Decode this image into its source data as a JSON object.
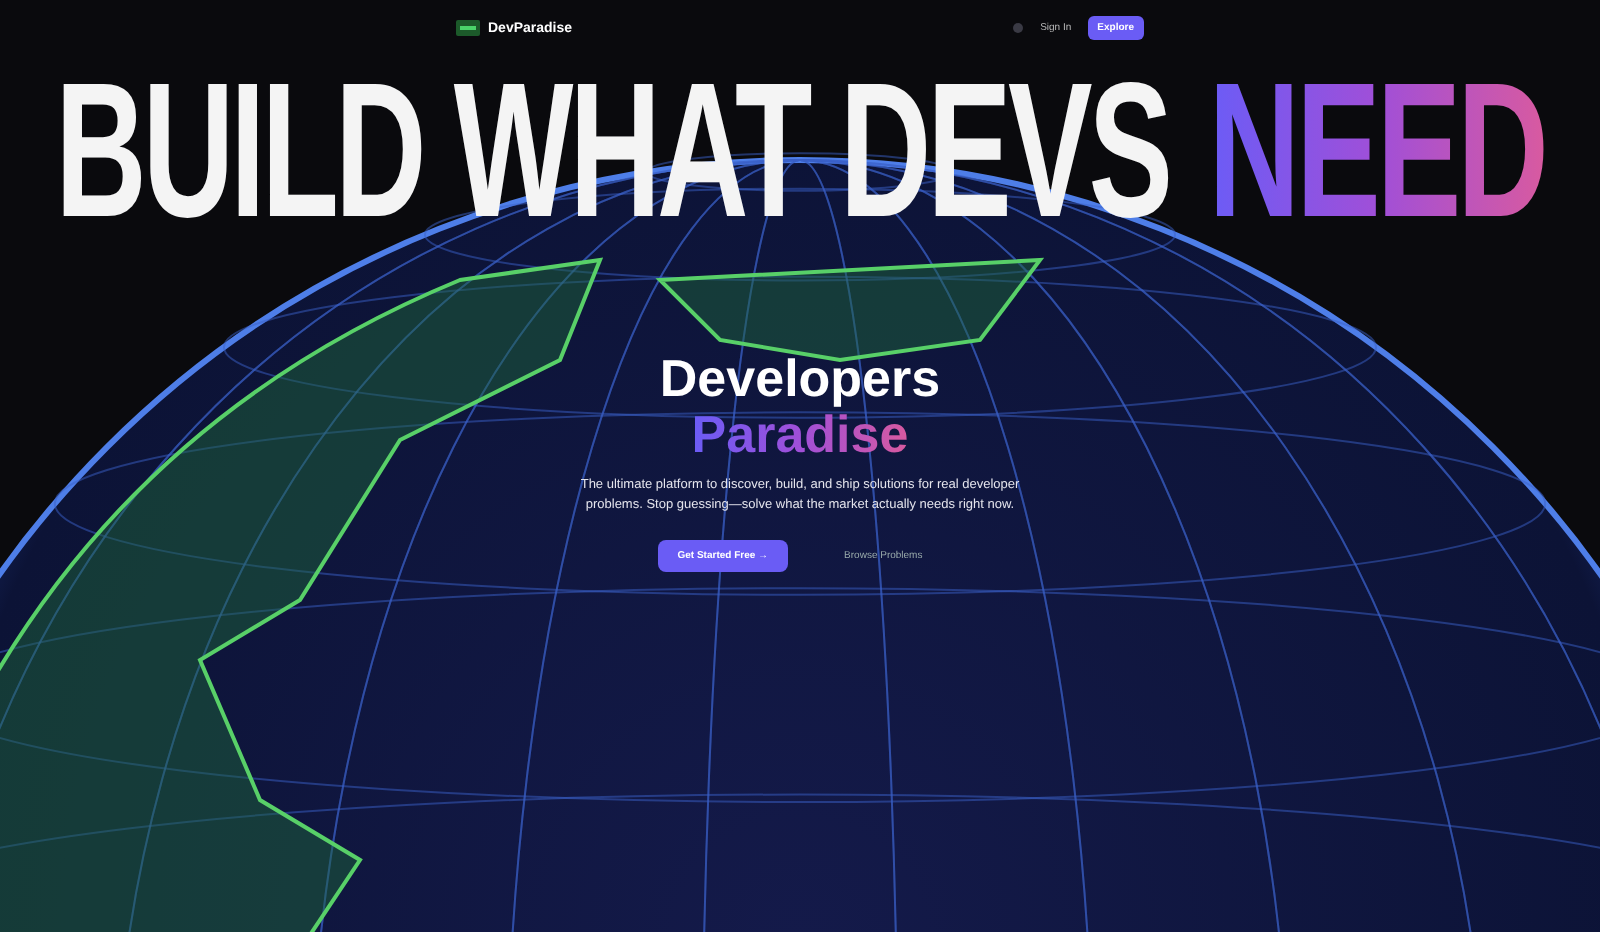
{
  "nav": {
    "brand": "DevParadise",
    "sign_in": "Sign In",
    "explore": "Explore"
  },
  "headline": [
    {
      "text": "BUILD WHAT DEVS",
      "kind": "plain"
    },
    {
      "text": "NEED",
      "kind": "gradient"
    }
  ],
  "hero": {
    "title": "Developers",
    "subtitle": "Paradise",
    "description": "The ultimate platform to discover, build, and ship solutions for real developer problems. Stop guessing—solve what the market actually needs right now.",
    "primary_button": "Get Started Free",
    "primary_arrow": "→",
    "secondary_button": "Browse Problems"
  }
}
